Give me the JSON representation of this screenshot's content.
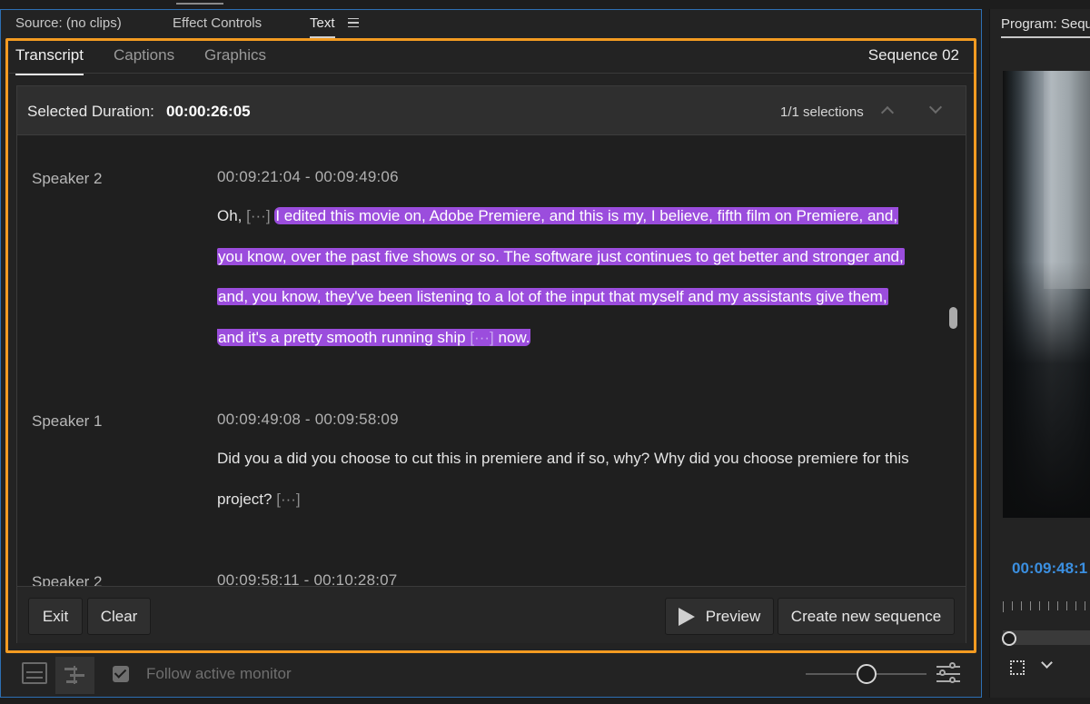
{
  "top_tabs": {
    "source": "Source: (no clips)",
    "effect_controls": "Effect Controls",
    "text": "Text"
  },
  "sub_tabs": {
    "transcript": "Transcript",
    "captions": "Captions",
    "graphics": "Graphics",
    "sequence_name": "Sequence 02"
  },
  "selection": {
    "label": "Selected Duration:",
    "value": "00:00:26:05",
    "count": "1/1 selections"
  },
  "transcript": {
    "blocks": [
      {
        "speaker": "Speaker 2",
        "timecode": "00:09:21:04 - 00:09:49:06",
        "lines": {
          "l1": {
            "pre": "Oh,",
            "ellipsis": "[···]",
            "hl": "I edited this movie on, Adobe Premiere, and this is my, I believe, fifth film on Premiere, and,"
          },
          "l2": "you know, over the past five shows or so. The software just continues to get better and stronger and,",
          "l3": "and, you know, they've been listening to a lot of the input that myself and my assistants give them,",
          "l4": {
            "hl": "and it's a pretty smooth running ship",
            "ellipsis": "[···]",
            "tail": "now."
          }
        }
      },
      {
        "speaker": "Speaker 1",
        "timecode": "00:09:49:08 - 00:09:58:09",
        "lines": {
          "l1": "Did you a did you choose to cut this in premiere and if so, why? Why did you choose premiere for this",
          "l2": "project?",
          "ellipsis": "[···]"
        }
      },
      {
        "speaker": "Speaker 2",
        "timecode": "00:09:58:11 - 00:10:28:07"
      }
    ]
  },
  "footer": {
    "exit": "Exit",
    "clear": "Clear",
    "preview": "Preview",
    "create": "Create new sequence"
  },
  "bottom": {
    "follow_label": "Follow active monitor",
    "follow_checked": true
  },
  "program": {
    "title": "Program: Seque",
    "timecode": "00:09:48:1"
  },
  "colors": {
    "highlight": "#9b4ddd",
    "accent_frame": "#f39b21",
    "timecode_blue": "#3b8fe0"
  }
}
